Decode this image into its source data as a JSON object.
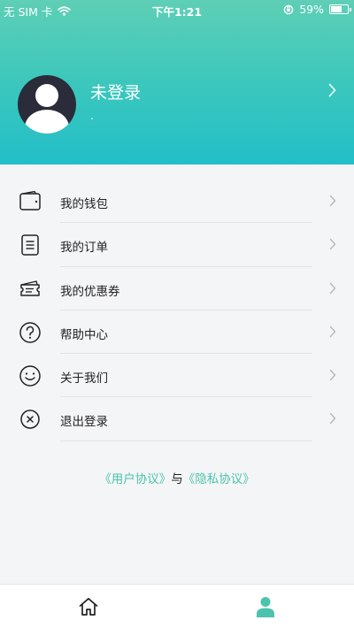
{
  "statusbar": {
    "carrier": "无 SIM 卡",
    "time": "下午1:21",
    "battery": "59%",
    "battery_level": 0.59
  },
  "profile": {
    "name": "未登录",
    "subtitle": "."
  },
  "menu": [
    {
      "label": "我的钱包",
      "icon": "wallet-icon"
    },
    {
      "label": "我的订单",
      "icon": "order-list-icon"
    },
    {
      "label": "我的优惠券",
      "icon": "coupon-icon"
    },
    {
      "label": "帮助中心",
      "icon": "help-circle-icon"
    },
    {
      "label": "关于我们",
      "icon": "smiley-icon"
    },
    {
      "label": "退出登录",
      "icon": "close-circle-icon"
    }
  ],
  "agreement": {
    "user": "《用户协议》",
    "and": "与",
    "privacy": "《隐私协议》"
  },
  "tabs": [
    {
      "name": "home",
      "icon": "home-icon"
    },
    {
      "name": "profile",
      "icon": "user-icon",
      "active": true
    }
  ],
  "colors": {
    "accent": "#4cc3ad",
    "header_top": "#5fcfb6",
    "header_bottom": "#22bfc8"
  }
}
